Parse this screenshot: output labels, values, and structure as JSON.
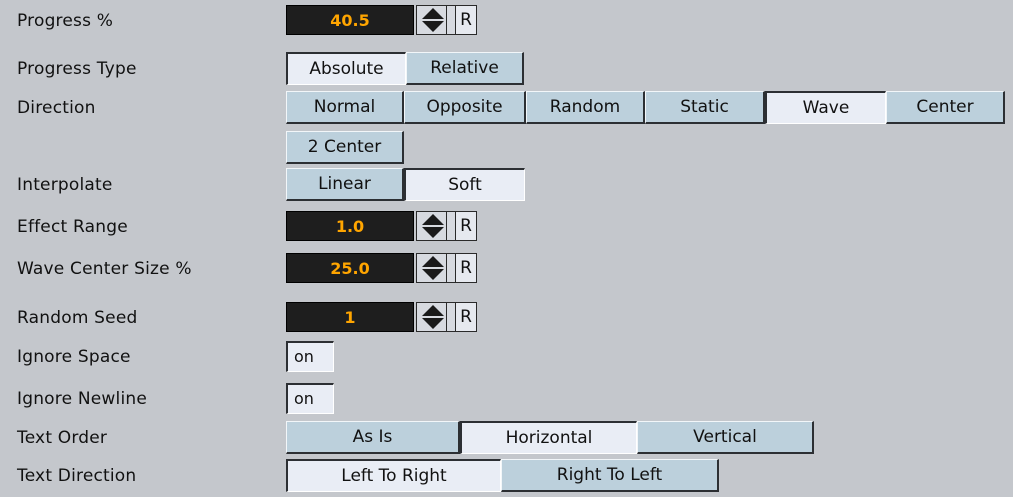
{
  "rows": {
    "progress": {
      "label": "Progress %",
      "value": "40.5",
      "reset": "R"
    },
    "progress_type": {
      "label": "Progress Type",
      "options": [
        "Absolute",
        "Relative"
      ],
      "selected": "Absolute"
    },
    "direction": {
      "label": "Direction",
      "options": [
        "Normal",
        "Opposite",
        "Random",
        "Static",
        "Wave",
        "Center",
        "2 Center"
      ],
      "selected": "Wave"
    },
    "interpolate": {
      "label": "Interpolate",
      "options": [
        "Linear",
        "Soft"
      ],
      "selected": "Soft"
    },
    "effect_range": {
      "label": "Effect Range",
      "value": "1.0",
      "reset": "R"
    },
    "wave_center_size": {
      "label": "Wave Center Size %",
      "value": "25.0",
      "reset": "R"
    },
    "random_seed": {
      "label": "Random Seed",
      "value": "1",
      "reset": "R"
    },
    "ignore_space": {
      "label": "Ignore Space",
      "value": "on"
    },
    "ignore_newline": {
      "label": "Ignore Newline",
      "value": "on"
    },
    "text_order": {
      "label": "Text Order",
      "options": [
        "As Is",
        "Horizontal",
        "Vertical"
      ],
      "selected": "Horizontal"
    },
    "text_direction": {
      "label": "Text Direction",
      "options": [
        "Left To Right",
        "Right To Left"
      ],
      "selected": "Left To Right"
    }
  },
  "colors": {
    "panel_bg": "#c4c7cc",
    "field_bg": "#1e1e1e",
    "field_text": "#ffa500",
    "button_off": "#bcd0dc",
    "button_on": "#e9edf5"
  },
  "icons": {
    "spinner": "up-down-arrows-icon"
  }
}
